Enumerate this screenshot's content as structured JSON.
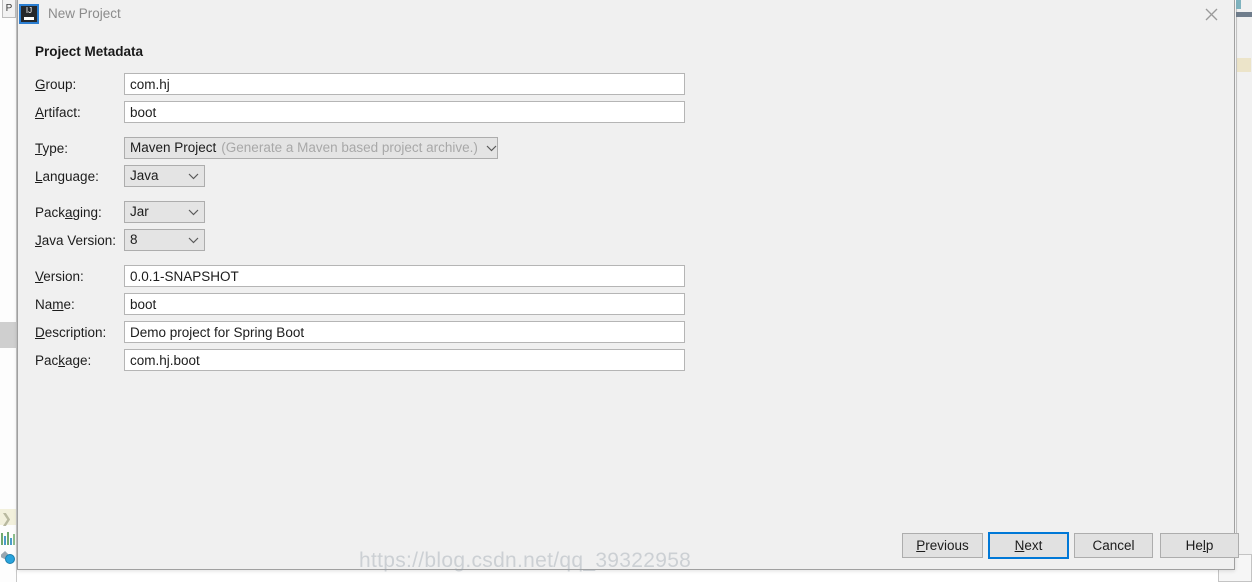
{
  "window": {
    "title": "New Project",
    "app_icon": "intellij-idea-icon",
    "close_icon": "close-icon"
  },
  "section": {
    "heading": "Project Metadata"
  },
  "fields": [
    {
      "id": "group",
      "label_pre": "",
      "label_key": "G",
      "label_post": "roup:",
      "type": "text",
      "value": "com.hj"
    },
    {
      "id": "artifact",
      "label_pre": "",
      "label_key": "A",
      "label_post": "rtifact:",
      "type": "text",
      "value": "boot"
    },
    {
      "id": "type",
      "label_pre": "",
      "label_key": "T",
      "label_post": "ype:",
      "type": "select",
      "value": "Maven Project",
      "hint": "(Generate a Maven based project archive.)",
      "width": "wide"
    },
    {
      "id": "language",
      "label_pre": "",
      "label_key": "L",
      "label_post": "anguage:",
      "type": "select",
      "value": "Java",
      "hint": "",
      "width": "small"
    },
    {
      "id": "packaging",
      "label_pre": "Pack",
      "label_key": "a",
      "label_post": "ging:",
      "type": "select",
      "value": "Jar",
      "hint": "",
      "width": "small"
    },
    {
      "id": "java-version",
      "label_pre": "",
      "label_key": "J",
      "label_post": "ava Version:",
      "type": "select",
      "value": "8",
      "hint": "",
      "width": "small"
    },
    {
      "id": "version",
      "label_pre": "",
      "label_key": "V",
      "label_post": "ersion:",
      "type": "text",
      "value": "0.0.1-SNAPSHOT"
    },
    {
      "id": "name",
      "label_pre": "Na",
      "label_key": "m",
      "label_post": "e:",
      "type": "text",
      "value": "boot"
    },
    {
      "id": "description",
      "label_pre": "",
      "label_key": "D",
      "label_post": "escription:",
      "type": "text",
      "value": "Demo project for Spring Boot"
    },
    {
      "id": "package",
      "label_pre": "Pac",
      "label_key": "k",
      "label_post": "age:",
      "type": "text",
      "value": "com.hj.boot"
    }
  ],
  "buttons": [
    {
      "id": "previous",
      "pre": "",
      "key": "P",
      "post": "revious",
      "focused": false
    },
    {
      "id": "next",
      "pre": "",
      "key": "N",
      "post": "ext",
      "focused": true
    },
    {
      "id": "cancel",
      "pre": "Cancel",
      "key": "",
      "post": "",
      "focused": false
    },
    {
      "id": "help",
      "pre": "He",
      "key": "l",
      "post": "p",
      "focused": false
    }
  ],
  "watermark": {
    "text": "https://blog.csdn.net/qq_39322958"
  },
  "background": {
    "tab_label": "P"
  },
  "colors": {
    "dialog_bg": "#f0f0f0",
    "field_bg": "#ffffff",
    "combo_bg": "#e4e4e4",
    "focus_ring": "#0078d7",
    "title_text": "#8b8b8b",
    "hint_text": "#a8a8a8"
  }
}
